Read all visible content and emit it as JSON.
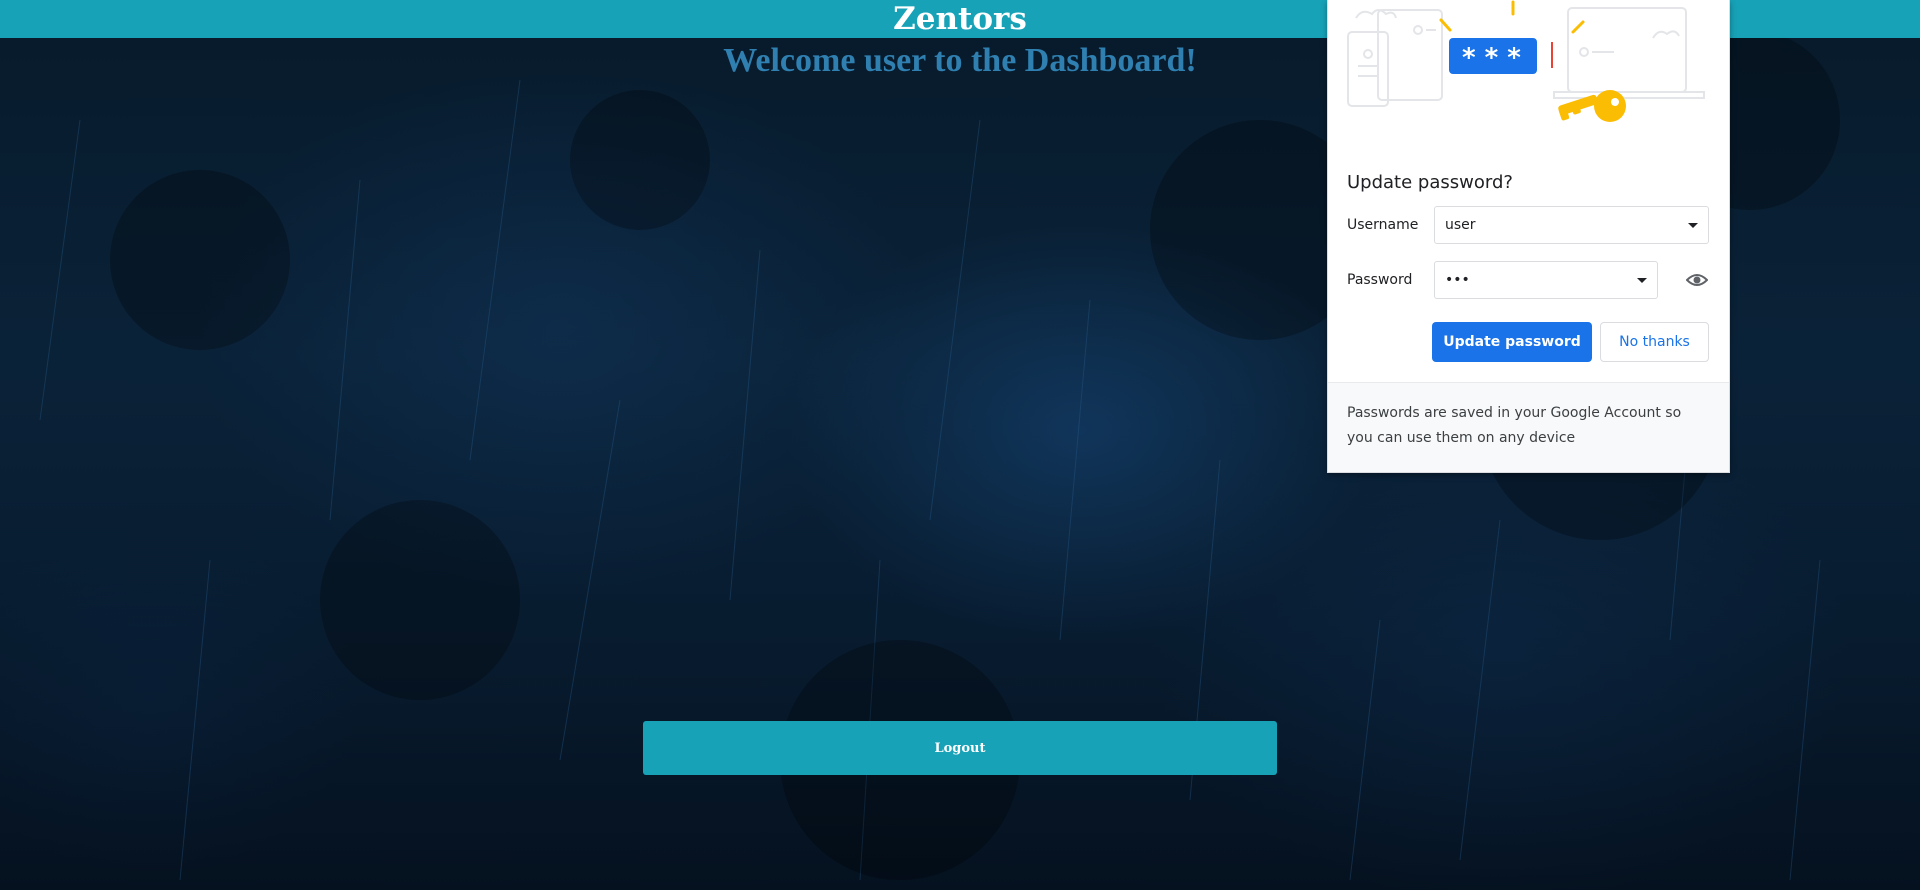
{
  "page": {
    "brand": "Zentors",
    "welcome_text": "Welcome user to the Dashboard!",
    "logout_label": "Logout",
    "colors": {
      "topbar": "#17a2b8",
      "welcome_text": "#2f7fb0",
      "logout_button": "#17a2b8",
      "background": "#0a2238"
    }
  },
  "password_bubble": {
    "title": "Update password?",
    "username_label": "Username",
    "username_value": "user",
    "password_label": "Password",
    "password_value": "•••",
    "reveal_icon": "eye-icon",
    "primary_button": "Update password",
    "secondary_button": "No thanks",
    "footer_text": "Passwords are saved in your Google Account so you can use them on any device",
    "illustration_text": "* * *",
    "colors": {
      "primary": "#1a73e8",
      "key": "#fbbc04"
    }
  }
}
